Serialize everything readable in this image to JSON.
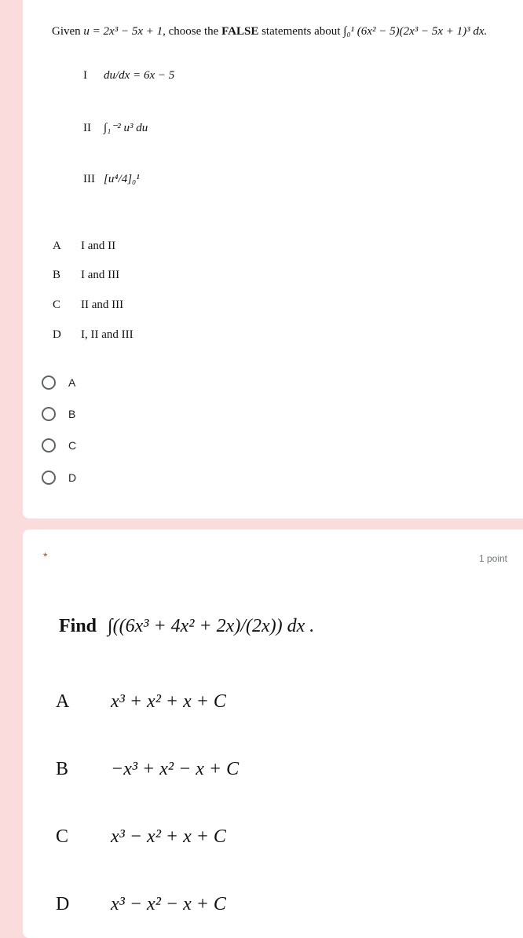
{
  "q1": {
    "prompt_prefix": "Given",
    "u_def": "u = 2x³ − 5x + 1",
    "prompt_mid": ", choose the",
    "prompt_bold": "FALSE",
    "prompt_suffix": "statements about",
    "integral": "∫₀¹ (6x² − 5)(2x³ − 5x + 1)³ dx.",
    "statements": [
      {
        "label": "I",
        "text": "du/dx = 6x − 5"
      },
      {
        "label": "II",
        "text": "∫₁⁻² u³ du"
      },
      {
        "label": "III",
        "text": "[u⁴/4]₀¹"
      }
    ],
    "options": [
      {
        "letter": "A",
        "text": "I and II"
      },
      {
        "letter": "B",
        "text": "I and III"
      },
      {
        "letter": "C",
        "text": "II and III"
      },
      {
        "letter": "D",
        "text": "I, II and III"
      }
    ],
    "radios": [
      "A",
      "B",
      "C",
      "D"
    ]
  },
  "q2": {
    "required_mark": "*",
    "points": "1 point",
    "prompt": "Find",
    "integral": "∫((6x³ + 4x² + 2x)/(2x)) dx .",
    "options": [
      {
        "letter": "A",
        "text": "x³ + x² + x + C"
      },
      {
        "letter": "B",
        "text": "−x³ + x² − x + C"
      },
      {
        "letter": "C",
        "text": "x³ − x² + x + C"
      },
      {
        "letter": "D",
        "text": "x³ − x² − x + C"
      }
    ]
  },
  "colors": {
    "background": "#fadcdd",
    "card": "#ffffff",
    "required": "#d93025"
  }
}
